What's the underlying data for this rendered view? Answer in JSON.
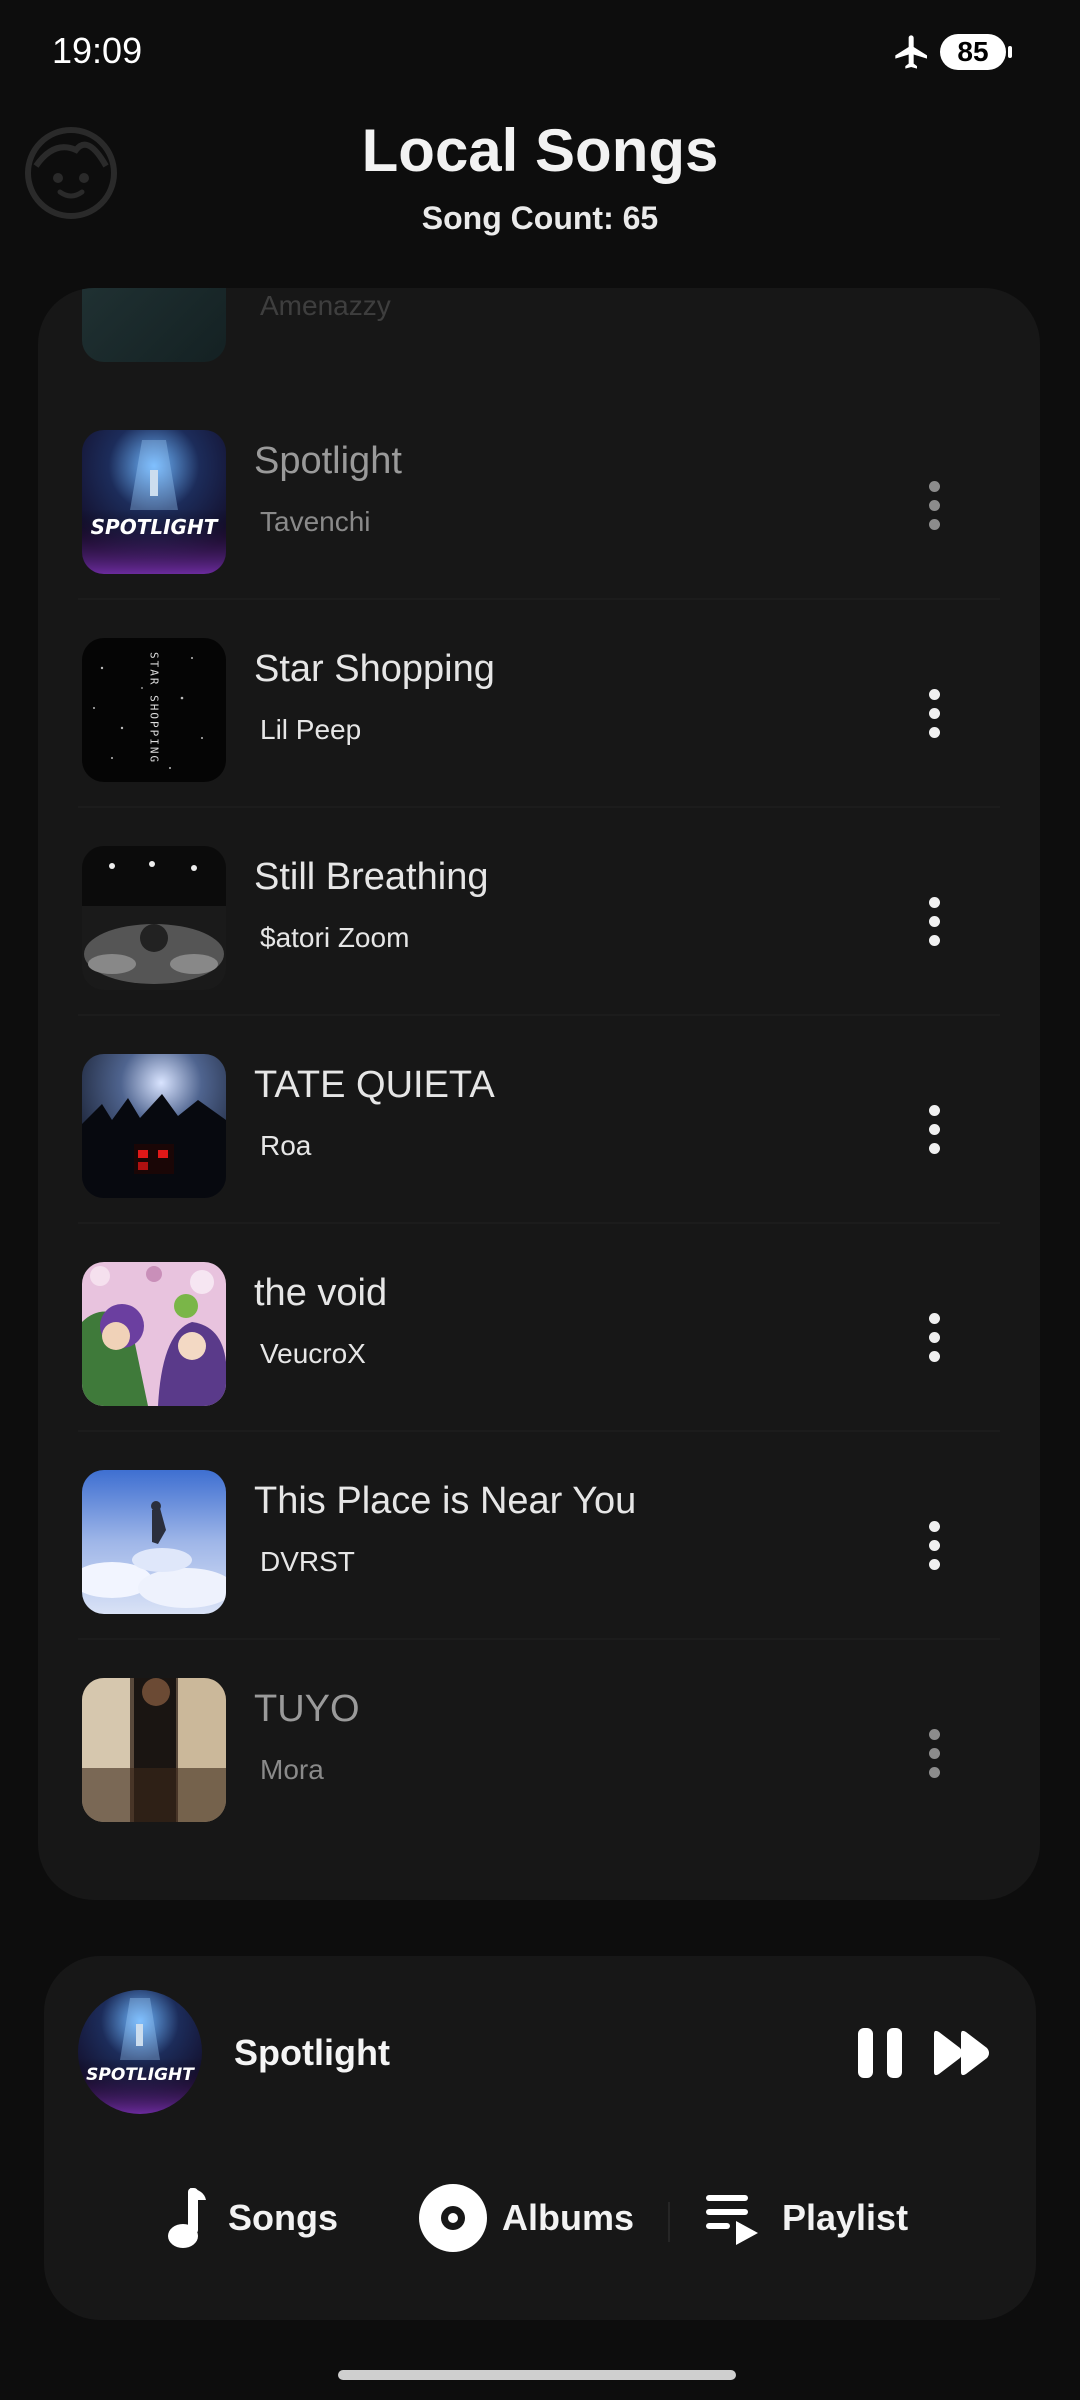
{
  "status_bar": {
    "time": "19:09",
    "battery": "85"
  },
  "header": {
    "title": "Local Songs",
    "song_count": "Song Count: 65"
  },
  "songs": [
    {
      "title": "Spotlight",
      "artist": "Tavenchi",
      "cover_text": "SPOTLIGHT"
    },
    {
      "title": "Star Shopping",
      "artist": "Lil Peep",
      "cover_text": "STAR SHOPPING"
    },
    {
      "title": "Still Breathing",
      "artist": "$atori Zoom"
    },
    {
      "title": "TATE QUIETA",
      "artist": "Roa"
    },
    {
      "title": "the void",
      "artist": "VeucroX"
    },
    {
      "title": "This Place is Near You",
      "artist": "DVRST"
    },
    {
      "title": "TUYO",
      "artist": "Mora"
    }
  ],
  "partial_song": {
    "artist": "Amenazzy"
  },
  "now_playing": {
    "title": "Spotlight",
    "cover_text": "SPOTLIGHT"
  },
  "nav": {
    "songs": "Songs",
    "albums": "Albums",
    "playlist": "Playlist"
  },
  "colors": {
    "background": "#0d0d0d",
    "card": "#171717",
    "text": "#e6e6e6"
  }
}
